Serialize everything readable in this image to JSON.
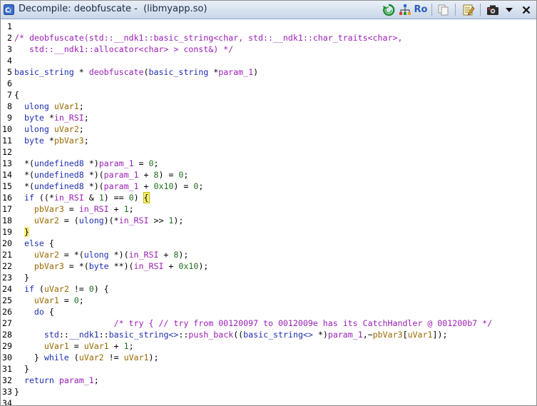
{
  "window": {
    "title": "Decompile: deobfuscate -  (libmyapp.so)"
  },
  "toolbar": {
    "ro_label": "Ro",
    "icons": [
      "refresh-icon",
      "graph-icon",
      "ro-toggle",
      "copy-icon",
      "edit-icon",
      "snapshot-icon",
      "menu-dropdown-icon",
      "close-icon"
    ]
  },
  "code": {
    "lines": [
      {
        "n": "1",
        "segs": []
      },
      {
        "n": "2",
        "segs": [
          {
            "c": "cm",
            "t": "/* deobfuscate(std::__ndk1::basic_string<char, std::__ndk1::char_traits<char>,"
          }
        ]
      },
      {
        "n": "3",
        "segs": [
          {
            "c": "cm",
            "t": "   std::__ndk1::allocator<char> > const&) */"
          }
        ]
      },
      {
        "n": "4",
        "segs": []
      },
      {
        "n": "5",
        "segs": [
          {
            "c": "ty",
            "t": "basic_string"
          },
          {
            "c": "",
            "t": " * "
          },
          {
            "c": "fn",
            "t": "deobfuscate"
          },
          {
            "c": "",
            "t": "("
          },
          {
            "c": "ty",
            "t": "basic_string"
          },
          {
            "c": "",
            "t": " *"
          },
          {
            "c": "pm",
            "t": "param_1"
          },
          {
            "c": "",
            "t": ")"
          }
        ]
      },
      {
        "n": "6",
        "segs": []
      },
      {
        "n": "7",
        "segs": [
          {
            "c": "",
            "t": "{"
          }
        ]
      },
      {
        "n": "8",
        "segs": [
          {
            "c": "",
            "t": "  "
          },
          {
            "c": "ty",
            "t": "ulong"
          },
          {
            "c": "",
            "t": " "
          },
          {
            "c": "vr",
            "t": "uVar1"
          },
          {
            "c": "",
            "t": ";"
          }
        ]
      },
      {
        "n": "9",
        "segs": [
          {
            "c": "",
            "t": "  "
          },
          {
            "c": "ty",
            "t": "byte"
          },
          {
            "c": "",
            "t": " *"
          },
          {
            "c": "pm",
            "t": "in_RSI"
          },
          {
            "c": "",
            "t": ";"
          }
        ]
      },
      {
        "n": "10",
        "segs": [
          {
            "c": "",
            "t": "  "
          },
          {
            "c": "ty",
            "t": "ulong"
          },
          {
            "c": "",
            "t": " "
          },
          {
            "c": "vr",
            "t": "uVar2"
          },
          {
            "c": "",
            "t": ";"
          }
        ]
      },
      {
        "n": "11",
        "segs": [
          {
            "c": "",
            "t": "  "
          },
          {
            "c": "ty",
            "t": "byte"
          },
          {
            "c": "",
            "t": " *"
          },
          {
            "c": "vr",
            "t": "pbVar3"
          },
          {
            "c": "",
            "t": ";"
          }
        ]
      },
      {
        "n": "12",
        "segs": []
      },
      {
        "n": "13",
        "segs": [
          {
            "c": "",
            "t": "  *("
          },
          {
            "c": "ty",
            "t": "undefined8"
          },
          {
            "c": "",
            "t": " *)"
          },
          {
            "c": "pm",
            "t": "param_1"
          },
          {
            "c": "",
            "t": " = "
          },
          {
            "c": "nm",
            "t": "0"
          },
          {
            "c": "",
            "t": ";"
          }
        ]
      },
      {
        "n": "14",
        "segs": [
          {
            "c": "",
            "t": "  *("
          },
          {
            "c": "ty",
            "t": "undefined8"
          },
          {
            "c": "",
            "t": " *)("
          },
          {
            "c": "pm",
            "t": "param_1"
          },
          {
            "c": "",
            "t": " + "
          },
          {
            "c": "nm",
            "t": "8"
          },
          {
            "c": "",
            "t": ") = "
          },
          {
            "c": "nm",
            "t": "0"
          },
          {
            "c": "",
            "t": ";"
          }
        ]
      },
      {
        "n": "15",
        "segs": [
          {
            "c": "",
            "t": "  *("
          },
          {
            "c": "ty",
            "t": "undefined8"
          },
          {
            "c": "",
            "t": " *)("
          },
          {
            "c": "pm",
            "t": "param_1"
          },
          {
            "c": "",
            "t": " + "
          },
          {
            "c": "nm",
            "t": "0x10"
          },
          {
            "c": "",
            "t": ") = "
          },
          {
            "c": "nm",
            "t": "0"
          },
          {
            "c": "",
            "t": ";"
          }
        ]
      },
      {
        "n": "16",
        "segs": [
          {
            "c": "",
            "t": "  "
          },
          {
            "c": "kw",
            "t": "if"
          },
          {
            "c": "",
            "t": " ((*"
          },
          {
            "c": "pm",
            "t": "in_RSI"
          },
          {
            "c": "",
            "t": " & "
          },
          {
            "c": "nm",
            "t": "1"
          },
          {
            "c": "",
            "t": ") == "
          },
          {
            "c": "nm",
            "t": "0"
          },
          {
            "c": "",
            "t": ") "
          },
          {
            "c": "cursor-hl",
            "t": "{"
          }
        ]
      },
      {
        "n": "17",
        "segs": [
          {
            "c": "",
            "t": "    "
          },
          {
            "c": "vr",
            "t": "pbVar3"
          },
          {
            "c": "",
            "t": " = "
          },
          {
            "c": "pm",
            "t": "in_RSI"
          },
          {
            "c": "",
            "t": " + "
          },
          {
            "c": "nm",
            "t": "1"
          },
          {
            "c": "",
            "t": ";"
          }
        ]
      },
      {
        "n": "18",
        "segs": [
          {
            "c": "",
            "t": "    "
          },
          {
            "c": "vr",
            "t": "uVar2"
          },
          {
            "c": "",
            "t": " = ("
          },
          {
            "c": "ty",
            "t": "ulong"
          },
          {
            "c": "",
            "t": ")(*"
          },
          {
            "c": "pm",
            "t": "in_RSI"
          },
          {
            "c": "",
            "t": " >> "
          },
          {
            "c": "nm",
            "t": "1"
          },
          {
            "c": "",
            "t": ");"
          }
        ]
      },
      {
        "n": "19",
        "segs": [
          {
            "c": "",
            "t": "  "
          },
          {
            "c": "hl",
            "t": "}"
          }
        ]
      },
      {
        "n": "20",
        "segs": [
          {
            "c": "",
            "t": "  "
          },
          {
            "c": "kw",
            "t": "else"
          },
          {
            "c": "",
            "t": " {"
          }
        ]
      },
      {
        "n": "21",
        "segs": [
          {
            "c": "",
            "t": "    "
          },
          {
            "c": "vr",
            "t": "uVar2"
          },
          {
            "c": "",
            "t": " = *("
          },
          {
            "c": "ty",
            "t": "ulong"
          },
          {
            "c": "",
            "t": " *)("
          },
          {
            "c": "pm",
            "t": "in_RSI"
          },
          {
            "c": "",
            "t": " + "
          },
          {
            "c": "nm",
            "t": "8"
          },
          {
            "c": "",
            "t": ");"
          }
        ]
      },
      {
        "n": "22",
        "segs": [
          {
            "c": "",
            "t": "    "
          },
          {
            "c": "vr",
            "t": "pbVar3"
          },
          {
            "c": "",
            "t": " = *("
          },
          {
            "c": "ty",
            "t": "byte"
          },
          {
            "c": "",
            "t": " **)("
          },
          {
            "c": "pm",
            "t": "in_RSI"
          },
          {
            "c": "",
            "t": " + "
          },
          {
            "c": "nm",
            "t": "0x10"
          },
          {
            "c": "",
            "t": ");"
          }
        ]
      },
      {
        "n": "23",
        "segs": [
          {
            "c": "",
            "t": "  }"
          }
        ]
      },
      {
        "n": "24",
        "segs": [
          {
            "c": "",
            "t": "  "
          },
          {
            "c": "kw",
            "t": "if"
          },
          {
            "c": "",
            "t": " ("
          },
          {
            "c": "vr",
            "t": "uVar2"
          },
          {
            "c": "",
            "t": " != "
          },
          {
            "c": "nm",
            "t": "0"
          },
          {
            "c": "",
            "t": ") {"
          }
        ]
      },
      {
        "n": "25",
        "segs": [
          {
            "c": "",
            "t": "    "
          },
          {
            "c": "vr",
            "t": "uVar1"
          },
          {
            "c": "",
            "t": " = "
          },
          {
            "c": "nm",
            "t": "0"
          },
          {
            "c": "",
            "t": ";"
          }
        ]
      },
      {
        "n": "26",
        "segs": [
          {
            "c": "",
            "t": "    "
          },
          {
            "c": "kw",
            "t": "do"
          },
          {
            "c": "",
            "t": " {"
          }
        ]
      },
      {
        "n": "27",
        "segs": [
          {
            "c": "",
            "t": "                    "
          },
          {
            "c": "cm",
            "t": "/* try { // try from 00120097 to 0012009e has its CatchHandler @ 001200b7 */"
          }
        ]
      },
      {
        "n": "28",
        "segs": [
          {
            "c": "",
            "t": "      "
          },
          {
            "c": "ty",
            "t": "std"
          },
          {
            "c": "",
            "t": "::"
          },
          {
            "c": "ty",
            "t": "__ndk1"
          },
          {
            "c": "",
            "t": "::"
          },
          {
            "c": "ty",
            "t": "basic_string<>"
          },
          {
            "c": "",
            "t": "::"
          },
          {
            "c": "fn",
            "t": "push_back"
          },
          {
            "c": "",
            "t": "(("
          },
          {
            "c": "ty",
            "t": "basic_string<>"
          },
          {
            "c": "",
            "t": " *)"
          },
          {
            "c": "pm",
            "t": "param_1"
          },
          {
            "c": "",
            "t": ",~"
          },
          {
            "c": "vr",
            "t": "pbVar3"
          },
          {
            "c": "",
            "t": "["
          },
          {
            "c": "vr",
            "t": "uVar1"
          },
          {
            "c": "",
            "t": "]);"
          }
        ]
      },
      {
        "n": "29",
        "segs": [
          {
            "c": "",
            "t": "      "
          },
          {
            "c": "vr",
            "t": "uVar1"
          },
          {
            "c": "",
            "t": " = "
          },
          {
            "c": "vr",
            "t": "uVar1"
          },
          {
            "c": "",
            "t": " + "
          },
          {
            "c": "nm",
            "t": "1"
          },
          {
            "c": "",
            "t": ";"
          }
        ]
      },
      {
        "n": "30",
        "segs": [
          {
            "c": "",
            "t": "    } "
          },
          {
            "c": "kw",
            "t": "while"
          },
          {
            "c": "",
            "t": " ("
          },
          {
            "c": "vr",
            "t": "uVar2"
          },
          {
            "c": "",
            "t": " != "
          },
          {
            "c": "vr",
            "t": "uVar1"
          },
          {
            "c": "",
            "t": ");"
          }
        ]
      },
      {
        "n": "31",
        "segs": [
          {
            "c": "",
            "t": "  }"
          }
        ]
      },
      {
        "n": "32",
        "segs": [
          {
            "c": "",
            "t": "  "
          },
          {
            "c": "kw",
            "t": "return"
          },
          {
            "c": "",
            "t": " "
          },
          {
            "c": "pm",
            "t": "param_1"
          },
          {
            "c": "",
            "t": ";"
          }
        ]
      },
      {
        "n": "33",
        "segs": [
          {
            "c": "",
            "t": "}"
          }
        ]
      },
      {
        "n": "34",
        "segs": []
      }
    ]
  }
}
